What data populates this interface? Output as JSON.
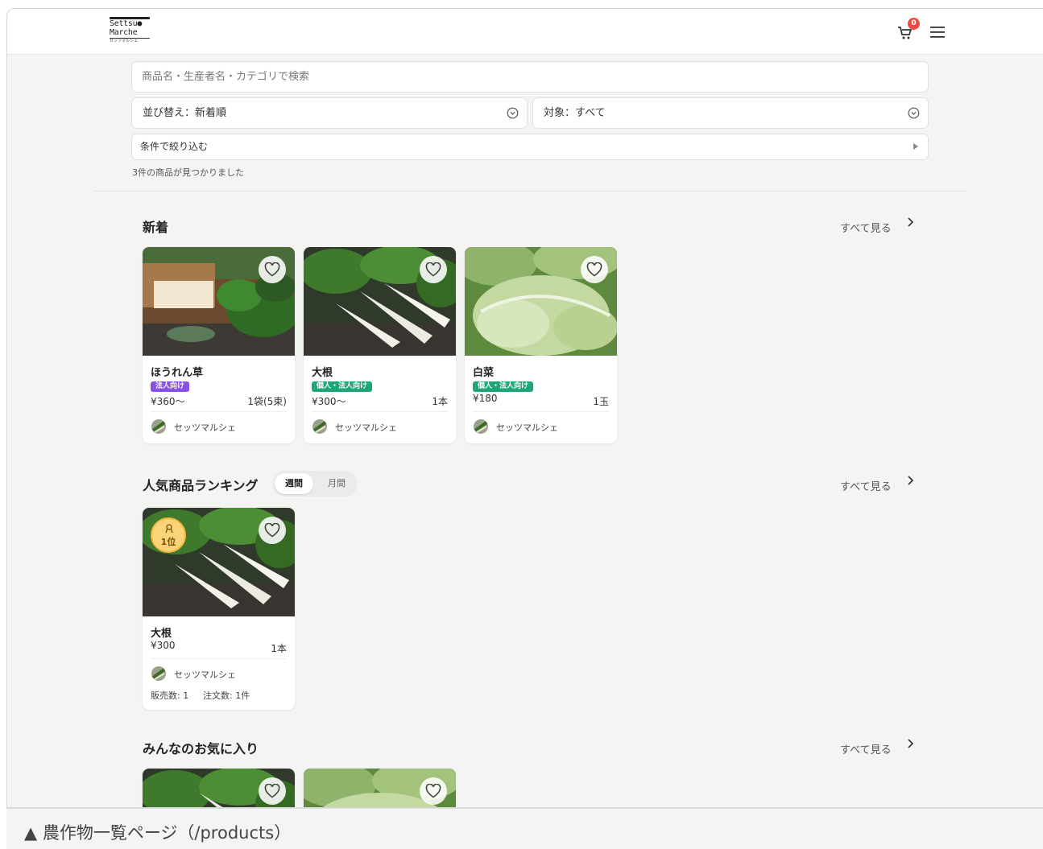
{
  "header": {
    "logo_line1": "Settsu●",
    "logo_line2": "Marche",
    "logo_line3": "セッツマルシェ",
    "cart_count": "0"
  },
  "search": {
    "placeholder": "商品名・生産者名・カテゴリで検索"
  },
  "sort": {
    "label": "並び替え：新着順"
  },
  "target": {
    "label": "対象：すべて"
  },
  "filter": {
    "label": "条件で絞り込む"
  },
  "result_count": "3件の商品が見つかりました",
  "sections": {
    "new": {
      "title": "新着",
      "see_all": "すべて見る",
      "items": [
        {
          "name": "ほうれん草",
          "badge": "法人向け",
          "price": "¥360〜",
          "unit": "1袋(5束)",
          "seller": "セッツマルシェ"
        },
        {
          "name": "大根",
          "badge": "個人・法人向け",
          "price": "¥300〜",
          "unit": "1本",
          "seller": "セッツマルシェ"
        },
        {
          "name": "白菜",
          "badge": "個人・法人向け",
          "price": "¥180",
          "unit": "1玉",
          "seller": "セッツマルシェ"
        }
      ]
    },
    "ranking": {
      "title": "人気商品ランキング",
      "see_all": "すべて見る",
      "tab_weekly": "週間",
      "tab_monthly": "月間",
      "items": [
        {
          "rank": "1位",
          "name": "大根",
          "price": "¥300",
          "unit": "1本",
          "seller": "セッツマルシェ",
          "sales": "販売数: 1",
          "orders": "注文数: 1件"
        }
      ]
    },
    "favorites": {
      "title": "みんなのお気に入り",
      "see_all": "すべて見る"
    }
  },
  "caption": "▲ 農作物一覧ページ（/products）",
  "colors": {
    "background": "#f4f4f3",
    "cart_badge": "#ef4b47",
    "badge_business": "#8a4fe6",
    "badge_both": "#1ea676",
    "rank_medal": "#fbd47a"
  }
}
